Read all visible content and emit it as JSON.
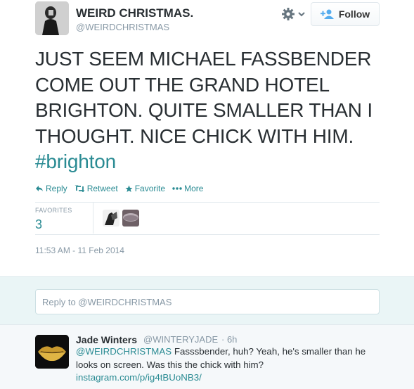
{
  "tweet": {
    "name": "WEIRD CHRISTMAS.",
    "handle": "@WEIRDCHRISTMAS",
    "follow_label": "Follow",
    "text_main": "JUST SEEM MICHAEL FASSBENDER COME OUT THE GRAND HOTEL BRIGHTON. QUITE SMALLER THAN I THOUGHT. NICE CHICK WITH HIM. ",
    "hashtag": "#brighton",
    "actions": {
      "reply": "Reply",
      "retweet": "Retweet",
      "favorite": "Favorite",
      "more": "More"
    },
    "favorites_label": "FAVORITES",
    "favorites_count": "3",
    "timestamp": "11:53 AM - 11 Feb 2014"
  },
  "reply_box": {
    "placeholder": "Reply to @WEIRDCHRISTMAS"
  },
  "reply_tweet": {
    "name": "Jade Winters",
    "handle": "@WINTERYJADE",
    "time": "· 6h",
    "mention": "@WEIRDCHRISTMAS",
    "text": " Fasssbender, huh? Yeah, he's smaller than he looks on screen. Was this the chick with him? ",
    "link": "instagram.com/p/ig4tBUoNB3/"
  },
  "colors": {
    "accent": "#2a8b93",
    "muted": "#8899a6",
    "text": "#292f33",
    "reply_area_bg": "#eaf5f6"
  },
  "icons": [
    "gear-icon",
    "chevron-down-icon",
    "add-user-icon",
    "reply-icon",
    "retweet-icon",
    "star-icon",
    "more-dots-icon"
  ]
}
